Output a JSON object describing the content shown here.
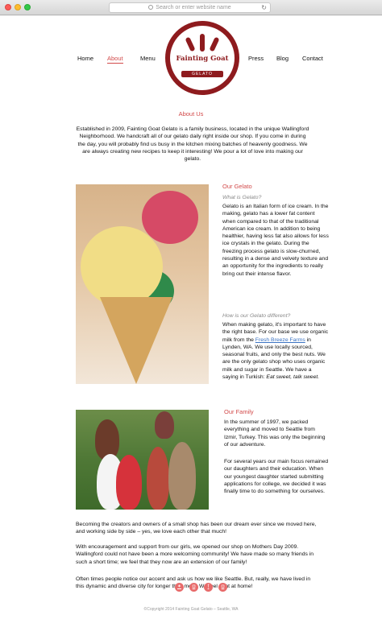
{
  "browser": {
    "address_placeholder": "Search or enter website name",
    "search_icon": "magnifier-icon",
    "reload_icon": "reload-icon"
  },
  "nav": {
    "home": "Home",
    "about": "About",
    "menu": "Menu",
    "press": "Press",
    "blog": "Blog",
    "contact": "Contact"
  },
  "logo": {
    "name": "Fainting Goat",
    "tagline": "GELATO"
  },
  "about": {
    "heading": "About Us",
    "intro": "Established in 2009, Fainting Goat Gelato is a family business, located in the unique Wallingford Neighborhood. We handcraft all of our gelato daily right inside our shop. If you come in during the day, you will probably find us busy in the kitchen mixing batches of heavenly goodness. We are always creating new recipes to keep it interesting! We pour a lot of love into making our gelato."
  },
  "gelato": {
    "heading": "Our Gelato",
    "q1": "What is Gelato?",
    "a1": "Gelato is an Italian form of ice cream. In the making, gelato has a lower fat content when compared to that of the traditional American ice cream. In addition to being healthier, having less fat also allows for less ice crystals in the gelato. During the freezing process gelato is slow-churned, resulting in a dense and velvety texture and an opportunity for the ingredients to really bring out their intense flavor.",
    "q2": "How is our Gelato different?",
    "a2_before": "When making gelato, it's important to have the right base. For our base we use organic milk from the ",
    "a2_link": "Fresh Breeze Farms",
    "a2_after": " in Lynden, WA. We use locally sourced, seasonal fruits, and only the best nuts. We are the only gelato shop who uses organic milk and sugar in Seattle. We have a saying in Turkish: ",
    "a2_italic": "Eat sweet, talk sweet."
  },
  "family": {
    "heading": "Our Family",
    "p1": "In the summer of 1997, we packed everything and moved to Seattle from Izmir, Turkey.  This was only the beginning of our adventure.",
    "p2": "For several years our main focus remained our daughters and their education. When our youngest daughter started submitting applications for college, we decided it was finally time to do something for ourselves.",
    "p3": "Becoming the creators and owners of a small shop has been our dream ever since we moved here, and working side by side – yes, we love each other that much!",
    "p4": "With encouragement and support from our girls, we opened our shop on Mothers Day 2009.  Wallingford could not have been a more welcoming community! We have made so many friends in such a short time; we feel that they now are an extension of our family!",
    "p5": "Often times people notice our accent and ask us how we like Seattle. But, really, we have lived in this dynamic and diverse city for longer than most. We feel right at home!"
  },
  "social": {
    "icons": [
      "yelp-icon",
      "instagram-icon",
      "facebook-icon",
      "instagram-icon"
    ],
    "facebook_glyph": "f"
  },
  "footer": {
    "copyright": "©Copyright 2014 Fainting Goat Gelato – Seattle, WA"
  },
  "colors": {
    "accent": "#d24a4a",
    "logo": "#8e1b1e",
    "link": "#3b73c3"
  }
}
